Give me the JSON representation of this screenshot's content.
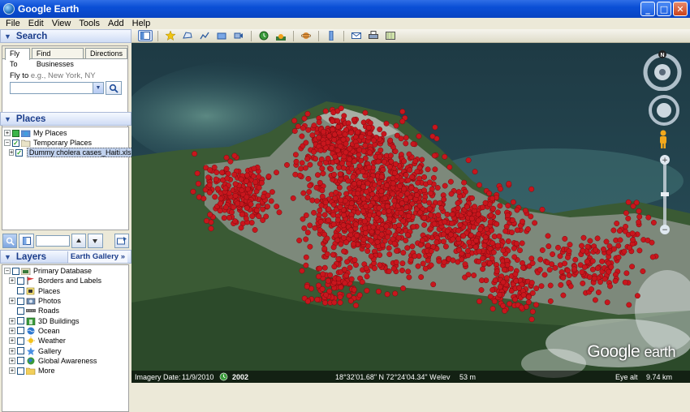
{
  "window": {
    "title": "Google Earth",
    "minimize": "_",
    "maximize": "□",
    "close": "✕"
  },
  "menu": [
    "File",
    "Edit",
    "View",
    "Tools",
    "Add",
    "Help"
  ],
  "search": {
    "header": "Search",
    "tabs": [
      "Fly To",
      "Find Businesses",
      "Directions"
    ],
    "flyto_label": "Fly to",
    "flyto_hint": "e.g., New York, NY",
    "flyto_value": ""
  },
  "places": {
    "header": "Places",
    "items": [
      {
        "label": "My Places",
        "expander": "+",
        "checked": true
      },
      {
        "label": "Temporary Places",
        "expander": "−",
        "checked": true
      },
      {
        "label": "Dummy cholera cases_Haiti.xls",
        "expander": "+",
        "checked": true,
        "selected": true
      }
    ]
  },
  "layers": {
    "header": "Layers",
    "gallery_label": "Earth Gallery",
    "gallery_arrow": "»",
    "items": [
      {
        "label": "Primary Database",
        "expander": "−",
        "icon": "database-icon"
      },
      {
        "label": "Borders and Labels",
        "expander": "+",
        "icon": "flag-icon"
      },
      {
        "label": "Places",
        "expander": "",
        "icon": "places-icon"
      },
      {
        "label": "Photos",
        "expander": "+",
        "icon": "photo-icon"
      },
      {
        "label": "Roads",
        "expander": "",
        "icon": "road-icon"
      },
      {
        "label": "3D Buildings",
        "expander": "+",
        "icon": "building-icon"
      },
      {
        "label": "Ocean",
        "expander": "+",
        "icon": "ocean-icon"
      },
      {
        "label": "Weather",
        "expander": "+",
        "icon": "weather-icon"
      },
      {
        "label": "Gallery",
        "expander": "+",
        "icon": "gallery-icon"
      },
      {
        "label": "Global Awareness",
        "expander": "+",
        "icon": "globe-icon"
      },
      {
        "label": "More",
        "expander": "+",
        "icon": "folder-icon"
      }
    ]
  },
  "status": {
    "imagery_date_label": "Imagery Date:",
    "imagery_date": "11/9/2010",
    "year": "2002",
    "coordinates": "18°32'01.68\" N  72°24'04.34\" W",
    "elev_label": "elev",
    "elev_value": "53 m",
    "eye_alt_label": "Eye alt",
    "eye_alt_value": "9.74 km"
  },
  "logo": {
    "google": "Google",
    "earth": "earth"
  },
  "nav": {
    "north_label": "N"
  },
  "colors": {
    "marker": "#c8161d",
    "title_bar": "#0a4fd6",
    "panel_header": "#1a3c8a"
  }
}
